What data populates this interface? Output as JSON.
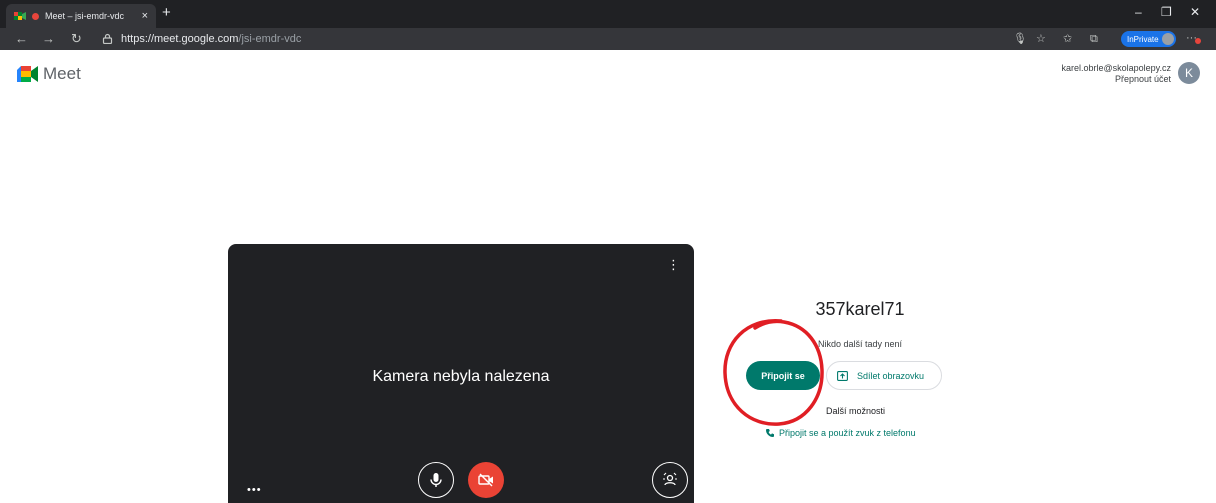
{
  "browser": {
    "tab_title": "Meet – jsi-emdr-vdc",
    "tab_close": "×",
    "new_tab": "+",
    "url_host": "https://meet.google.com",
    "url_path": "/jsi-emdr-vdc",
    "inprivate_label": "InPrivate",
    "window_controls": {
      "minimize": "–",
      "restore": "❐",
      "close": "✕"
    },
    "nav": {
      "back": "←",
      "forward": "→",
      "refresh": "↻"
    },
    "toolbar": {
      "mic": "🎙",
      "favorite": "☆",
      "favorites_bar": "✩",
      "collections": "⧉",
      "more": "···"
    }
  },
  "meet": {
    "brand": "Meet",
    "account": {
      "email": "karel.obrle@skolapolepy.cz",
      "switch_label": "Přepnout účet",
      "avatar_initial": "K"
    }
  },
  "preview": {
    "message": "Kamera nebyla nalezena",
    "more_icon": "⋮",
    "dots": "•••"
  },
  "join": {
    "meeting_name": "357karel71",
    "status": "Nikdo další tady není",
    "join_label": "Připojit se",
    "present_label": "Sdílet obrazovku",
    "other_options": "Další možnosti",
    "phone_label": "Připojit se a použít zvuk z telefonu"
  },
  "colors": {
    "accent": "#00796b",
    "danger": "#ea4335",
    "annotation": "#e01e24"
  }
}
